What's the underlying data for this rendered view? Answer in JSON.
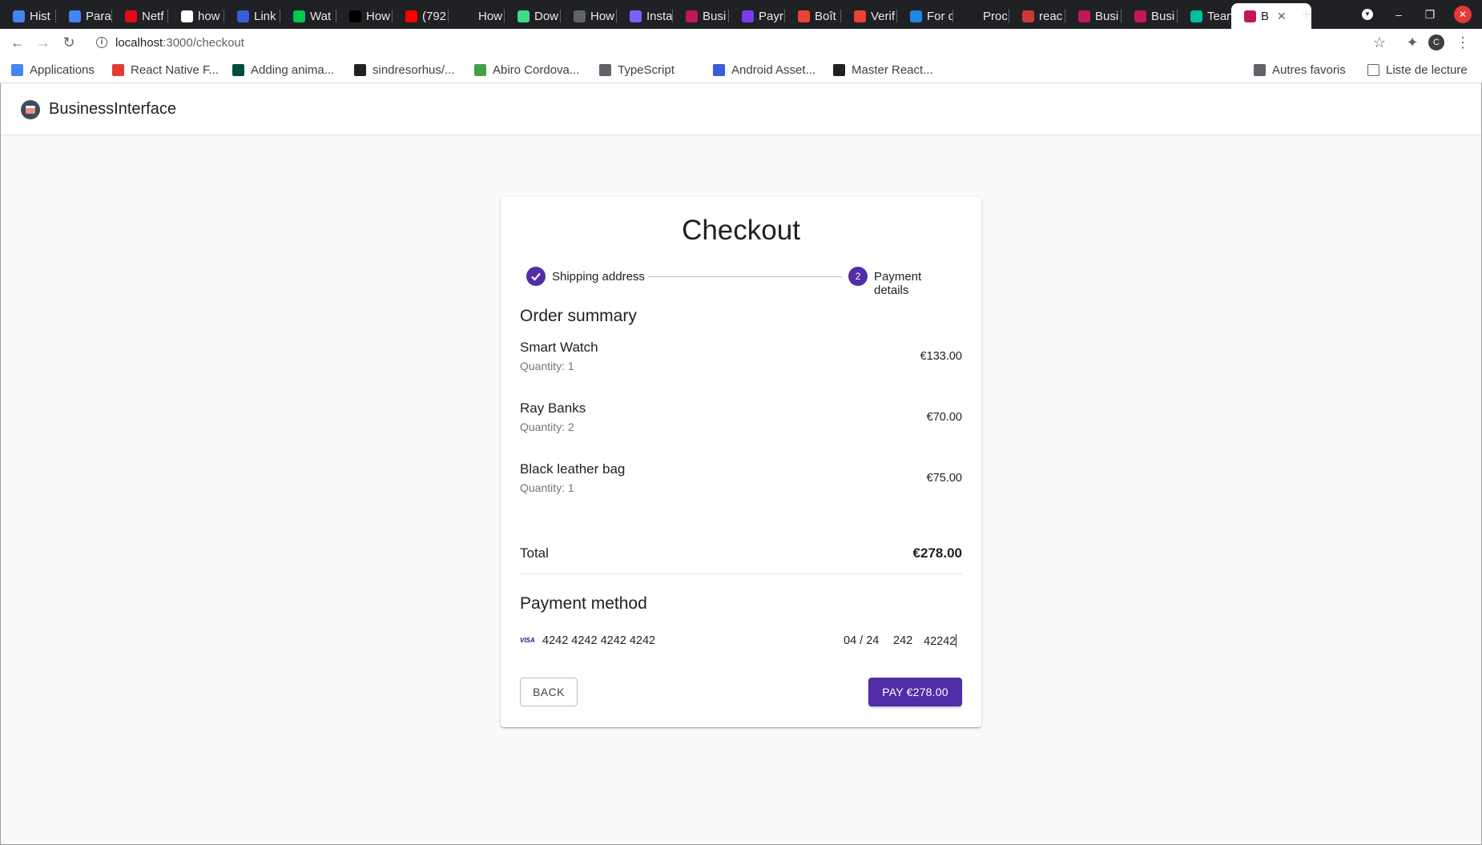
{
  "browser": {
    "tabs": [
      {
        "label": "Hist",
        "icon": "history-icon",
        "color": "#4285f4"
      },
      {
        "label": "Para",
        "icon": "settings-gear-icon",
        "color": "#4285f4"
      },
      {
        "label": "Netf",
        "icon": "netflix-icon",
        "color": "#e50914"
      },
      {
        "label": "how",
        "icon": "google-icon",
        "color": "#ffffff"
      },
      {
        "label": "Link",
        "icon": "link-icon",
        "color": "#3b5bdb"
      },
      {
        "label": "Wat",
        "icon": "brand-icon",
        "color": "#00c853"
      },
      {
        "label": "How",
        "icon": "hexagon-icon",
        "color": "#000000"
      },
      {
        "label": "(792",
        "icon": "youtube-icon",
        "color": "#ff0000"
      },
      {
        "label": "How",
        "icon": "t-icon",
        "color": "#202124"
      },
      {
        "label": "Dow",
        "icon": "cloud-icon",
        "color": "#3ddc84"
      },
      {
        "label": "How",
        "icon": "globe-icon",
        "color": "#5f6368"
      },
      {
        "label": "Insta",
        "icon": "insta-icon",
        "color": "#7b61ff"
      },
      {
        "label": "Busi",
        "icon": "app-icon",
        "color": "#c2185b"
      },
      {
        "label": "Payr",
        "icon": "s-icon",
        "color": "#7c3aed"
      },
      {
        "label": "Boît",
        "icon": "gmail-icon",
        "color": "#ea4335"
      },
      {
        "label": "Verif",
        "icon": "gmail-icon",
        "color": "#ea4335"
      },
      {
        "label": "For d",
        "icon": "arrow-icon",
        "color": "#1e88e5"
      },
      {
        "label": "Proc",
        "icon": "mountain-icon",
        "color": "#202124"
      },
      {
        "label": "reac",
        "icon": "npm-icon",
        "color": "#cb3837"
      },
      {
        "label": "Busi",
        "icon": "app-icon",
        "color": "#c2185b"
      },
      {
        "label": "Busi",
        "icon": "app-icon",
        "color": "#c2185b"
      },
      {
        "label": "Tean",
        "icon": "diamond-icon",
        "color": "#00bfa5"
      }
    ],
    "active_tab": {
      "label": "B",
      "close": "✕"
    },
    "new_tab": "+",
    "url_host": "localhost",
    "url_path": ":3000/checkout",
    "profile_initial": "C",
    "bookmarks": [
      {
        "label": "Applications",
        "color": "#4285f4"
      },
      {
        "label": "React Native F...",
        "color": "#e53935"
      },
      {
        "label": "Adding anima...",
        "color": "#004d40"
      },
      {
        "label": "sindresorhus/...",
        "color": "#202124"
      },
      {
        "label": "Abiro Cordova...",
        "color": "#43a047"
      },
      {
        "label": "TypeScript",
        "color": "#5f6368"
      },
      {
        "label": "Android Asset...",
        "color": "#3b5bdb"
      },
      {
        "label": "Master React...",
        "color": "#202124"
      }
    ],
    "other_bookmarks": "Autres favoris",
    "reading_list": "Liste de lecture"
  },
  "app": {
    "title": "BusinessInterface"
  },
  "checkout": {
    "title": "Checkout",
    "steps": [
      {
        "label": "Shipping address",
        "state": "completed",
        "icon": "check-icon"
      },
      {
        "label": "Payment details",
        "state": "active",
        "number": "2"
      }
    ],
    "order_summary_title": "Order summary",
    "items": [
      {
        "name": "Smart Watch",
        "quantity": "Quantity: 1",
        "price": "€133.00"
      },
      {
        "name": "Ray Banks",
        "quantity": "Quantity: 2",
        "price": "€70.00"
      },
      {
        "name": "Black leather bag",
        "quantity": "Quantity: 1",
        "price": "€75.00"
      }
    ],
    "total_label": "Total",
    "total_value": "€278.00",
    "payment_title": "Payment method",
    "card": {
      "brand": "VISA",
      "number": "4242 4242 4242 4242",
      "expiry": "04 / 24",
      "cvc": "242",
      "zip": "42242"
    },
    "back_label": "BACK",
    "pay_label": "PAY €278.00",
    "accent_color": "#512da8"
  }
}
